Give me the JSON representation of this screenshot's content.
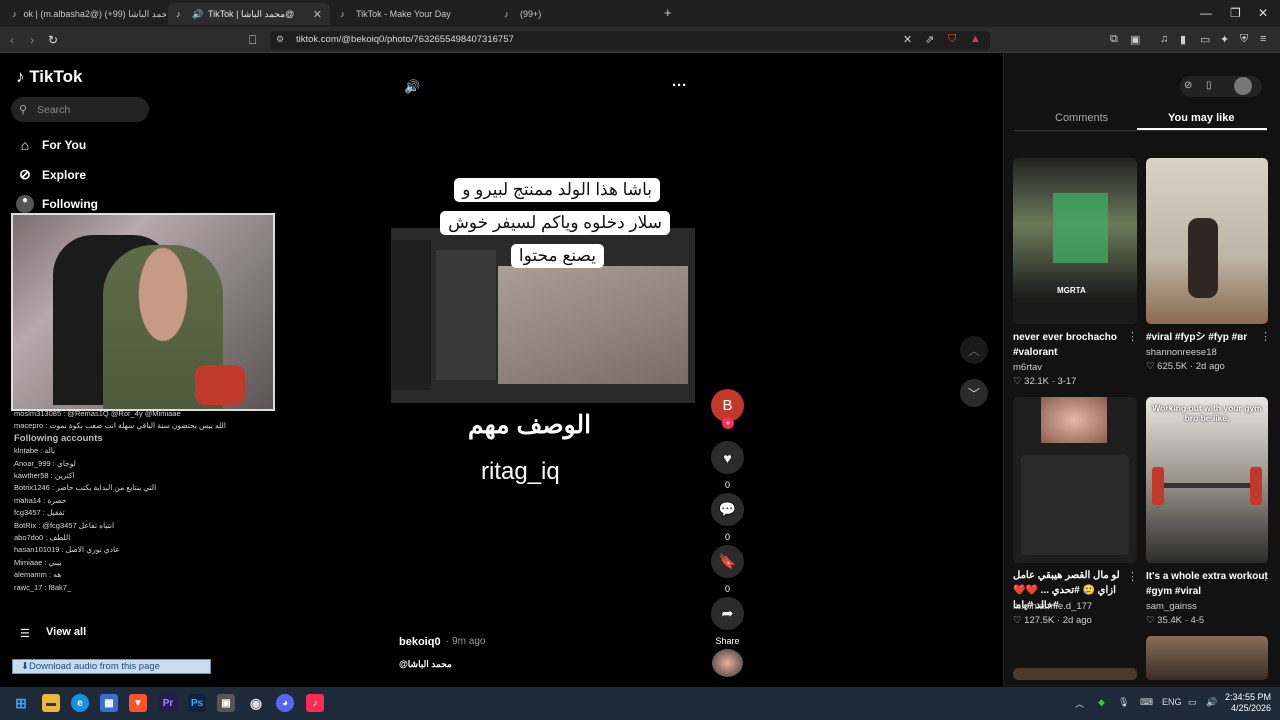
{
  "browser": {
    "tabs": [
      {
        "label": "ok | (m.albasha2@) محمد الباشا (99+)"
      },
      {
        "label": "TikTok | محمد الباشا@"
      },
      {
        "label": "TikTok - Make Your Day"
      },
      {
        "label": "(99+)"
      }
    ],
    "url": "tiktok.com/@bekoiq0/photo/7632655498407316757"
  },
  "sidebar": {
    "logo": "TikTok",
    "search_placeholder": "Search",
    "nav": [
      {
        "label": "For You",
        "icon": "home-icon"
      },
      {
        "label": "Explore",
        "icon": "compass-icon"
      },
      {
        "label": "Following",
        "icon": "avatar-icon"
      }
    ],
    "view_all": "View all",
    "overlay_chat": [
      "moslm313085 : @Remas1Q @Ror_4y @Mimiaae",
      "macepro : الله يبس يحتضون سنة الباقي سهلة انت صعب بكوة نموت",
      "Following accounts",
      "klntabe : يالة",
      "Anoar_999 : لوجاي",
      "kawther58 : اكثرين",
      "Botrix1246 : التي ينتابع من البداية يكتب حاضر",
      "maha14 : حضرة",
      "fcg3457 : تفقيل",
      "BotRix : @fcg3457 انتباه تفاعل",
      "abo7do0 : اللطف",
      "hasan101019 : عادي توري الاصل",
      "Mimiaae : بيبي",
      "alemamm : هه",
      "rawc_17 : f8ak7_"
    ],
    "download_bar": "Download audio from this page"
  },
  "post": {
    "caption_lines": [
      "باشا هذا الولد ممنتج لبيرو و",
      "سلار دخلوه وياكم لسيفر خوش",
      "يصنع محتوا"
    ],
    "overlay_title": "الوصف مهم",
    "overlay_sub": "ritag_iq",
    "author": "bekoiq0",
    "time": "· 9m ago",
    "handle": "@محمد الباشا",
    "avatar_letter": "B",
    "likes": "0",
    "comments": "0",
    "saves": "0",
    "share_label": "Share"
  },
  "right_panel": {
    "tab_comments": "Comments",
    "tab_you_may_like": "You may like",
    "cards": [
      {
        "title": "never ever brochacho #valorant",
        "author": "m6rtav",
        "likes": "32.1K",
        "date": "3-17"
      },
      {
        "title": "#viral #fypシ #fyp #вr",
        "author": "shannonreese18",
        "likes": "625.5K",
        "date": "2d ago"
      },
      {
        "title": "لو مال القصر هيبقي عامل ازاي 🥲 #تحدي ... ❤️❤️ #خالد #ياما",
        "author": "m.o.h.a.m.e.d_177",
        "likes": "127.5K",
        "date": "2d ago"
      },
      {
        "title": "It's a whole extra workout #gym #viral",
        "author": "sam_gainss",
        "likes": "35.4K",
        "date": "4-5"
      }
    ],
    "card3_thumb_text": "Working out with your gym bro be like.",
    "card1_thumb_text": "MGRTA"
  },
  "taskbar": {
    "time": "2:34:55 PM",
    "date": "4/25/2026",
    "lang": "ENG"
  }
}
